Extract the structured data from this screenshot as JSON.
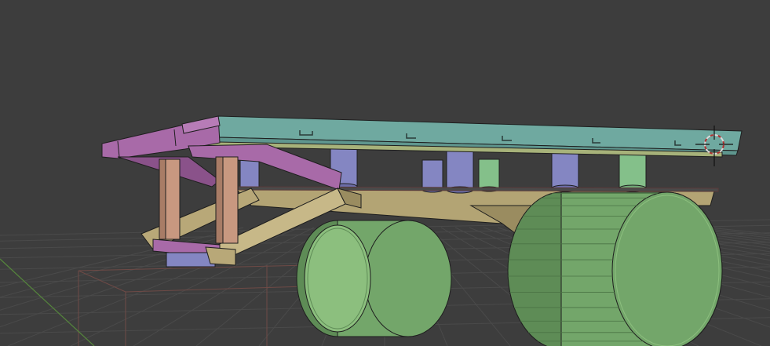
{
  "viewport": {
    "background": "#3d3d3d",
    "grid_color": "#4a4a4a",
    "grid_major_color": "#545454",
    "axis_x_color": "#7a3a3a",
    "axis_y_color": "#5a8a3a"
  },
  "model": {
    "palette": {
      "deck_top": "#6fa9a0",
      "deck_front": "#5f968e",
      "deck_edge": "#8ec0b8",
      "purple_rail": "#a86aa8",
      "purple_rail_dark": "#8a528a",
      "blue_post": "#8486c2",
      "blue_post_dark": "#6c6ea8",
      "green_post": "#84c08a",
      "tan_frame": "#b8a878",
      "tan_frame_dark": "#9a8c60",
      "salmon_leg": "#c89880",
      "salmon_leg_dark": "#a87c66",
      "wheel_face": "#73a66a",
      "wheel_rim": "#8cbf7e",
      "wheel_dark": "#5e8c56",
      "outline": "#1e1e1e"
    }
  },
  "cursor": {
    "icon": "3d-cursor-icon",
    "ring_outer": "#d9d9d9",
    "ring_inner": "#b03030"
  }
}
